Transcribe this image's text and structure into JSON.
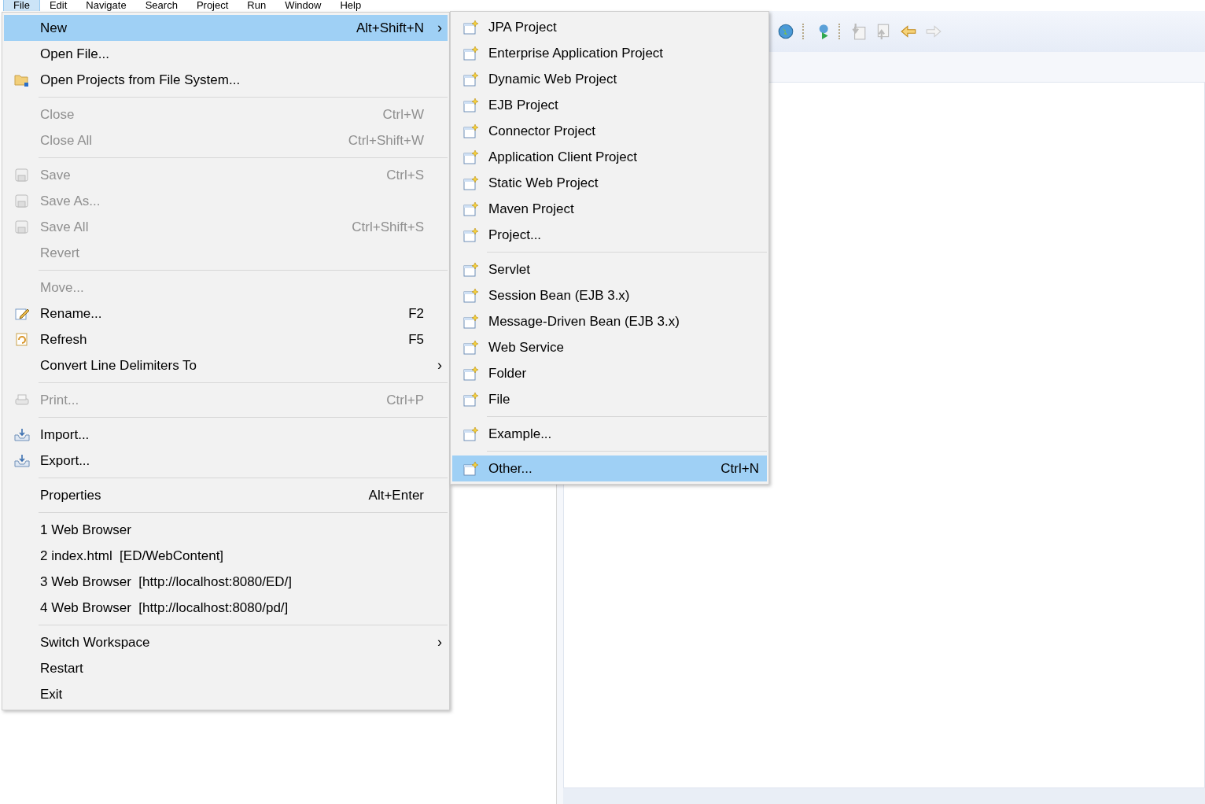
{
  "menubar": [
    {
      "label": "File",
      "selected": true
    },
    {
      "label": "Edit",
      "selected": false
    },
    {
      "label": "Navigate",
      "selected": false
    },
    {
      "label": "Search",
      "selected": false
    },
    {
      "label": "Project",
      "selected": false
    },
    {
      "label": "Run",
      "selected": false
    },
    {
      "label": "Window",
      "selected": false
    },
    {
      "label": "Help",
      "selected": false
    }
  ],
  "file_menu": [
    {
      "kind": "item",
      "label": "New",
      "shortcut": "Alt+Shift+N",
      "arrow": "›",
      "selected": true,
      "disabled": false,
      "icon": false
    },
    {
      "kind": "item",
      "label": "Open File...",
      "selected": false,
      "disabled": false,
      "icon": false
    },
    {
      "kind": "item",
      "label": "Open Projects from File System...",
      "selected": false,
      "disabled": false,
      "icon": true
    },
    {
      "kind": "separator"
    },
    {
      "kind": "item",
      "label": "Close",
      "shortcut": "Ctrl+W",
      "selected": false,
      "disabled": true,
      "icon": false
    },
    {
      "kind": "item",
      "label": "Close All",
      "shortcut": "Ctrl+Shift+W",
      "selected": false,
      "disabled": true,
      "icon": false
    },
    {
      "kind": "separator"
    },
    {
      "kind": "item",
      "label": "Save",
      "shortcut": "Ctrl+S",
      "selected": false,
      "disabled": true,
      "icon": true
    },
    {
      "kind": "item",
      "label": "Save As...",
      "selected": false,
      "disabled": true,
      "icon": true
    },
    {
      "kind": "item",
      "label": "Save All",
      "shortcut": "Ctrl+Shift+S",
      "selected": false,
      "disabled": true,
      "icon": true
    },
    {
      "kind": "item",
      "label": "Revert",
      "selected": false,
      "disabled": true,
      "icon": false
    },
    {
      "kind": "separator"
    },
    {
      "kind": "item",
      "label": "Move...",
      "selected": false,
      "disabled": true,
      "icon": false
    },
    {
      "kind": "item",
      "label": "Rename...",
      "shortcut": "F2",
      "selected": false,
      "disabled": false,
      "icon": true
    },
    {
      "kind": "item",
      "label": "Refresh",
      "shortcut": "F5",
      "selected": false,
      "disabled": false,
      "icon": true
    },
    {
      "kind": "item",
      "label": "Convert Line Delimiters To",
      "arrow": "›",
      "selected": false,
      "disabled": false,
      "icon": false
    },
    {
      "kind": "separator"
    },
    {
      "kind": "item",
      "label": "Print...",
      "shortcut": "Ctrl+P",
      "selected": false,
      "disabled": true,
      "icon": true
    },
    {
      "kind": "separator"
    },
    {
      "kind": "item",
      "label": "Import...",
      "selected": false,
      "disabled": false,
      "icon": true
    },
    {
      "kind": "item",
      "label": "Export...",
      "selected": false,
      "disabled": false,
      "icon": true
    },
    {
      "kind": "separator"
    },
    {
      "kind": "item",
      "label": "Properties",
      "shortcut": "Alt+Enter",
      "selected": false,
      "disabled": false,
      "icon": false
    },
    {
      "kind": "separator"
    },
    {
      "kind": "item",
      "label": "1 Web Browser",
      "selected": false,
      "disabled": false,
      "icon": false
    },
    {
      "kind": "item",
      "label": "2 index.html  [ED/WebContent]",
      "selected": false,
      "disabled": false,
      "icon": false
    },
    {
      "kind": "item",
      "label": "3 Web Browser  [http://localhost:8080/ED/]",
      "selected": false,
      "disabled": false,
      "icon": false
    },
    {
      "kind": "item",
      "label": "4 Web Browser  [http://localhost:8080/pd/]",
      "selected": false,
      "disabled": false,
      "icon": false
    },
    {
      "kind": "separator"
    },
    {
      "kind": "item",
      "label": "Switch Workspace",
      "arrow": "›",
      "selected": false,
      "disabled": false,
      "icon": false
    },
    {
      "kind": "item",
      "label": "Restart",
      "selected": false,
      "disabled": false,
      "icon": false
    },
    {
      "kind": "item",
      "label": "Exit",
      "selected": false,
      "disabled": false,
      "icon": false
    }
  ],
  "new_submenu": [
    {
      "kind": "item",
      "label": "JPA Project",
      "selected": false,
      "icon": true
    },
    {
      "kind": "item",
      "label": "Enterprise Application Project",
      "selected": false,
      "icon": true
    },
    {
      "kind": "item",
      "label": "Dynamic Web Project",
      "selected": false,
      "icon": true
    },
    {
      "kind": "item",
      "label": "EJB Project",
      "selected": false,
      "icon": true
    },
    {
      "kind": "item",
      "label": "Connector Project",
      "selected": false,
      "icon": true
    },
    {
      "kind": "item",
      "label": "Application Client Project",
      "selected": false,
      "icon": true
    },
    {
      "kind": "item",
      "label": "Static Web Project",
      "selected": false,
      "icon": true
    },
    {
      "kind": "item",
      "label": "Maven Project",
      "selected": false,
      "icon": true
    },
    {
      "kind": "item",
      "label": "Project...",
      "selected": false,
      "icon": true
    },
    {
      "kind": "separator"
    },
    {
      "kind": "item",
      "label": "Servlet",
      "selected": false,
      "icon": true
    },
    {
      "kind": "item",
      "label": "Session Bean (EJB 3.x)",
      "selected": false,
      "icon": true
    },
    {
      "kind": "item",
      "label": "Message-Driven Bean (EJB 3.x)",
      "selected": false,
      "icon": true
    },
    {
      "kind": "item",
      "label": "Web Service",
      "selected": false,
      "icon": true
    },
    {
      "kind": "item",
      "label": "Folder",
      "selected": false,
      "icon": true
    },
    {
      "kind": "item",
      "label": "File",
      "selected": false,
      "icon": true
    },
    {
      "kind": "separator"
    },
    {
      "kind": "item",
      "label": "Example...",
      "selected": false,
      "icon": true
    },
    {
      "kind": "separator"
    },
    {
      "kind": "item",
      "label": "Other...",
      "shortcut": "Ctrl+N",
      "selected": true,
      "icon": true
    }
  ]
}
